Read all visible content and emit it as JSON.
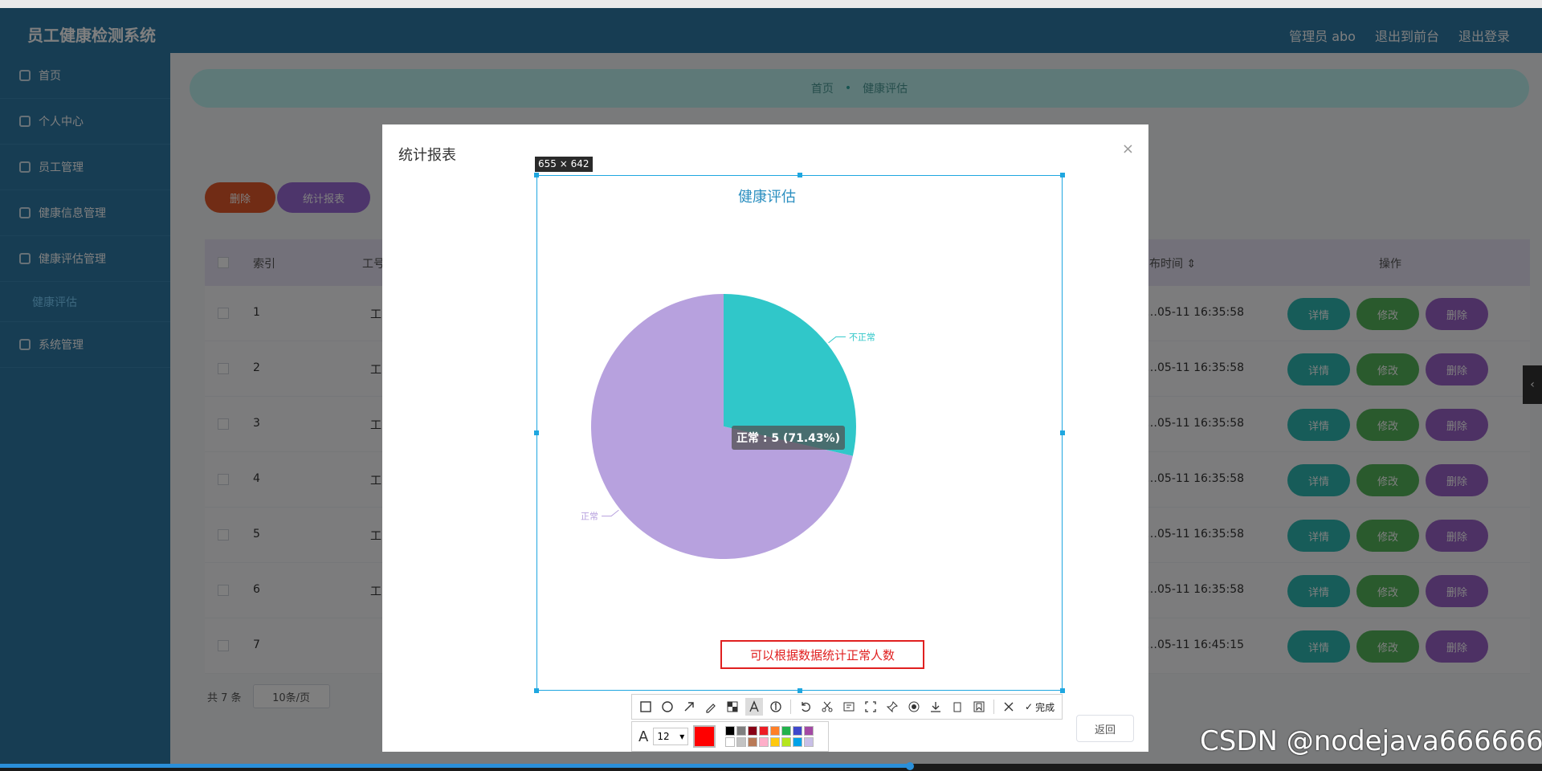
{
  "app": {
    "title": "员工健康检测系统",
    "header_links": [
      "管理员 abo",
      "退出到前台",
      "退出登录"
    ]
  },
  "sidebar": {
    "items": [
      {
        "label": "首页",
        "icon": "home-icon"
      },
      {
        "label": "个人中心",
        "icon": "user-icon"
      },
      {
        "label": "员工管理",
        "icon": "staff-icon"
      },
      {
        "label": "健康信息管理",
        "icon": "doc-icon"
      },
      {
        "label": "健康评估管理",
        "icon": "doc-icon"
      }
    ],
    "sub_item": "健康评估",
    "last_item": {
      "label": "系统管理",
      "icon": "gear-icon"
    }
  },
  "breadcrumb": {
    "home": "首页",
    "sep": "•",
    "current": "健康评估"
  },
  "toolbar": {
    "delete_label": "删除",
    "report_label": "统计报表"
  },
  "table": {
    "headers": {
      "index": "索引",
      "col2": "工号",
      "time": "…布时间 ⇕",
      "ops": "操作"
    },
    "rows": [
      {
        "index": "1",
        "col2": "工",
        "time": "…05-11 16:35:58"
      },
      {
        "index": "2",
        "col2": "工",
        "time": "…05-11 16:35:58"
      },
      {
        "index": "3",
        "col2": "工",
        "time": "…05-11 16:35:58"
      },
      {
        "index": "4",
        "col2": "工",
        "time": "…05-11 16:35:58"
      },
      {
        "index": "5",
        "col2": "工",
        "time": "…05-11 16:35:58"
      },
      {
        "index": "6",
        "col2": "工",
        "time": "…05-11 16:35:58"
      },
      {
        "index": "7",
        "col2": "",
        "time": "…05-11 16:45:15"
      }
    ],
    "ops": {
      "detail": "详情",
      "edit": "修改",
      "delete": "删除"
    }
  },
  "pager": {
    "total": "共 7 条",
    "page_size": "10条/页"
  },
  "dialog": {
    "title": "统计报表",
    "close": "×",
    "back": "返回"
  },
  "capture": {
    "size_label": "655 × 642"
  },
  "chart_data": {
    "type": "pie",
    "title": "健康评估",
    "slices": [
      {
        "name": "正常",
        "value": 5,
        "percent": 71.43,
        "color": "#b7a1de"
      },
      {
        "name": "不正常",
        "value": 2,
        "percent": 28.57,
        "color": "#30c7c9"
      }
    ],
    "tooltip": "正常 : 5 (71.43%)"
  },
  "annotation": {
    "note": "可以根据数据统计正常人数"
  },
  "capture_toolbar": {
    "tools": [
      "rect-icon",
      "ellipse-icon",
      "arrow-icon",
      "pen-icon",
      "mosaic-icon",
      "text-icon",
      "number-icon",
      "undo-icon",
      "cut-icon",
      "ocr-icon",
      "scroll-capture-icon",
      "pin-icon",
      "record-icon",
      "download-icon",
      "copy-icon",
      "bookmark-icon",
      "close-icon"
    ],
    "done_label": "完成",
    "font_size": "12",
    "current_color": "#ff0000",
    "palette": [
      "#000000",
      "#7f7f7f",
      "#880015",
      "#ed1c24",
      "#ff7f27",
      "#22b14c",
      "#3f48cc",
      "#a349a4",
      "#ffffff",
      "#c3c3c3",
      "#b97a57",
      "#ffaec9",
      "#ffc90e",
      "#b5e61d",
      "#00a2e8",
      "#c8bfe7"
    ]
  },
  "watermark": "CSDN @nodejava666666",
  "video": {
    "progress": 0.59
  }
}
